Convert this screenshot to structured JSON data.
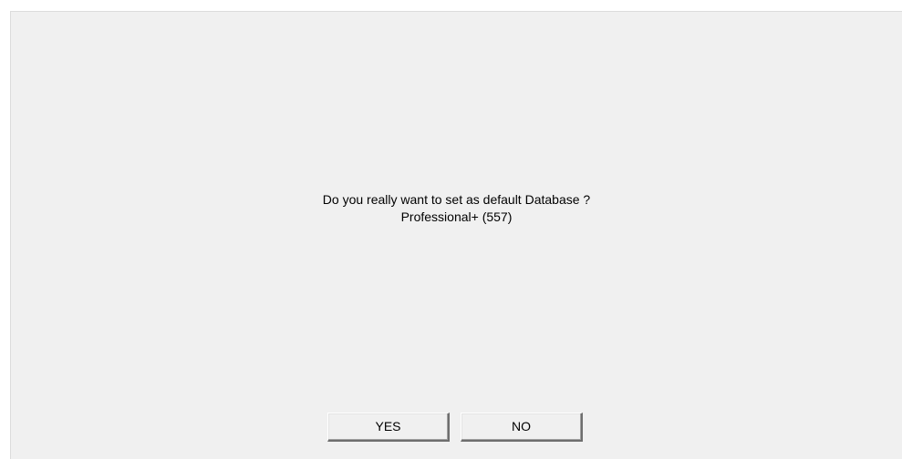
{
  "dialog": {
    "message_line1": "Do you really want to set as default Database ?",
    "message_line2": "Professional+ (557)",
    "yes_label": "YES",
    "no_label": "NO"
  }
}
